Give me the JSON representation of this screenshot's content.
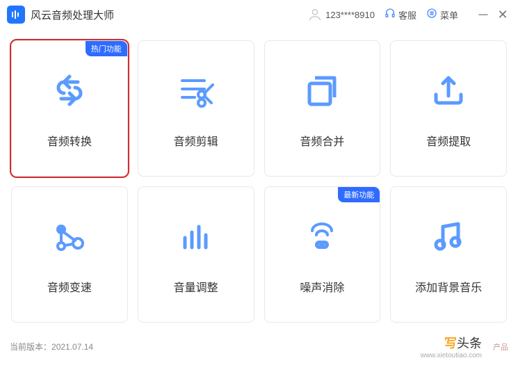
{
  "header": {
    "app_title": "风云音频处理大师",
    "phone": "123****8910",
    "kefu": "客服",
    "menu": "菜单"
  },
  "cards": [
    {
      "label": "音频转换",
      "badge": "热门功能",
      "highlight": true,
      "icon": "convert"
    },
    {
      "label": "音频剪辑",
      "badge": null,
      "highlight": false,
      "icon": "cut"
    },
    {
      "label": "音频合并",
      "badge": null,
      "highlight": false,
      "icon": "merge"
    },
    {
      "label": "音频提取",
      "badge": null,
      "highlight": false,
      "icon": "extract"
    },
    {
      "label": "音频变速",
      "badge": null,
      "highlight": false,
      "icon": "speed"
    },
    {
      "label": "音量调整",
      "badge": null,
      "highlight": false,
      "icon": "volume"
    },
    {
      "label": "噪声消除",
      "badge": "最新功能",
      "highlight": false,
      "icon": "noise"
    },
    {
      "label": "添加背景音乐",
      "badge": null,
      "highlight": false,
      "icon": "bgm"
    }
  ],
  "footer": {
    "version_label": "当前版本：",
    "version_value": "2021.07.14",
    "product_link": "产品",
    "watermark_text": "头条",
    "watermark_prefix": "写",
    "watermark_url": "www.xietoutiao.com"
  }
}
